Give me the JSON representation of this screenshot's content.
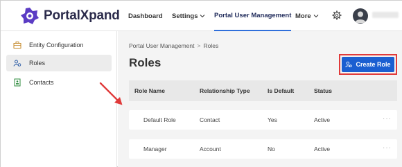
{
  "header": {
    "brand": "PortalXpand",
    "nav": {
      "dashboard": "Dashboard",
      "settings": "Settings",
      "portal_user_management": "Portal User Management",
      "more": "More"
    },
    "icons": {
      "logo": "portalxpand-logo",
      "settings": "gear-icon",
      "avatar": "user-avatar"
    },
    "colors": {
      "accent": "#2f6fdb",
      "brand_purple": "#5b3cc4"
    }
  },
  "sidebar": {
    "items": [
      {
        "label": "Entity Configuration",
        "icon": "briefcase-icon",
        "active": false
      },
      {
        "label": "Roles",
        "icon": "roles-icon",
        "active": true
      },
      {
        "label": "Contacts",
        "icon": "contact-card-icon",
        "active": false
      }
    ]
  },
  "main": {
    "breadcrumb": {
      "parent": "Portal User Management",
      "separator": ">",
      "current": "Roles"
    },
    "title": "Roles",
    "create_button": "Create Role",
    "table": {
      "columns": [
        "Role Name",
        "Relationship Type",
        "Is Default",
        "Status"
      ],
      "rows": [
        {
          "name": "Default Role",
          "relationship": "Contact",
          "is_default": "Yes",
          "status": "Active",
          "actions": "···"
        },
        {
          "name": "Manager",
          "relationship": "Account",
          "is_default": "No",
          "status": "Active",
          "actions": "···"
        }
      ]
    },
    "colors": {
      "button": "#1b5fd1",
      "highlight_outline": "#e03a3a",
      "arrow": "#e03a3a"
    }
  }
}
